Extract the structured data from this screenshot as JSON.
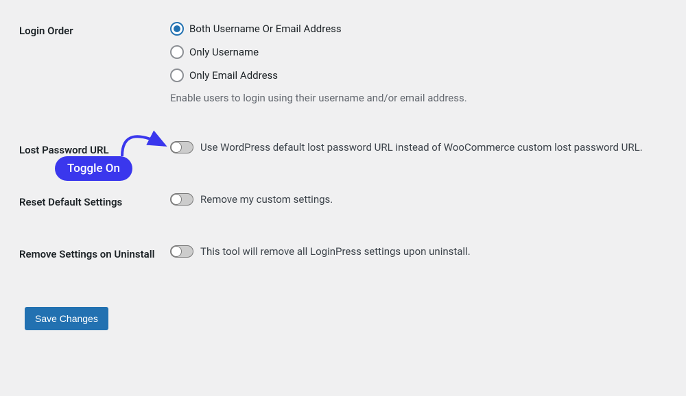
{
  "annotation": {
    "label": "Toggle On"
  },
  "loginOrder": {
    "label": "Login Order",
    "options": {
      "both": "Both Username Or Email Address",
      "username": "Only Username",
      "email": "Only Email Address"
    },
    "help": "Enable users to login using their username and/or email address."
  },
  "lostPassword": {
    "label": "Lost Password URL",
    "toggleLabel": "Use WordPress default lost password URL instead of WooCommerce custom lost password URL."
  },
  "resetDefaults": {
    "label": "Reset Default Settings",
    "toggleLabel": "Remove my custom settings."
  },
  "removeOnUninstall": {
    "label": "Remove Settings on Uninstall",
    "toggleLabel": "This tool will remove all LoginPress settings upon uninstall."
  },
  "saveButton": "Save Changes"
}
